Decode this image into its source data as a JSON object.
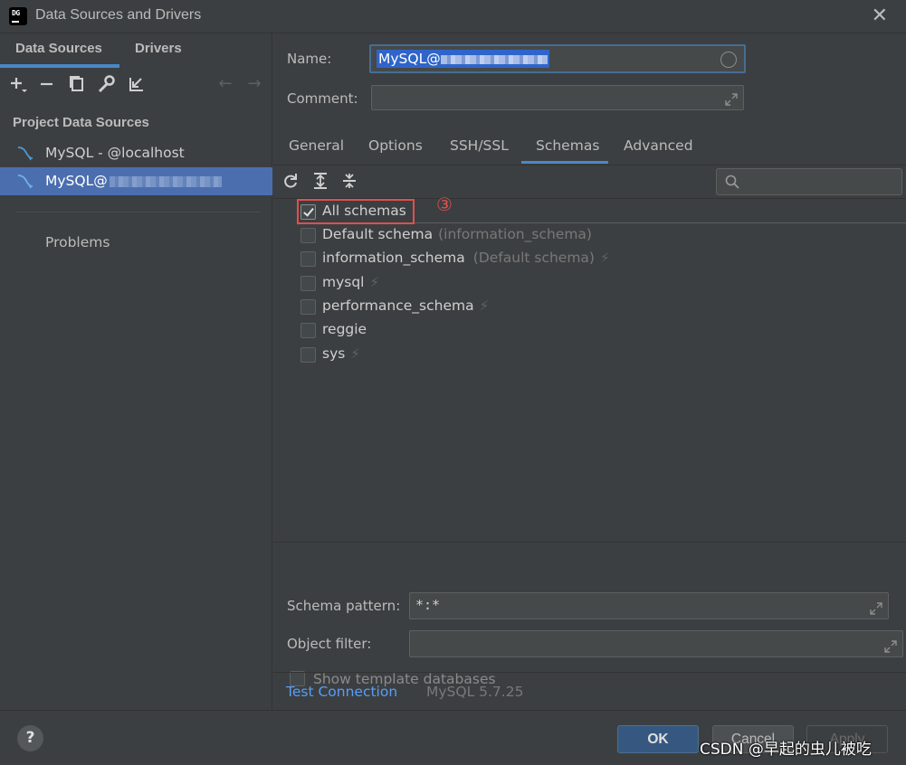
{
  "window": {
    "title": "Data Sources and Drivers"
  },
  "left_tabs": [
    "Data Sources",
    "Drivers"
  ],
  "section_title": "Project Data Sources",
  "data_sources": [
    {
      "label": "MySQL - @localhost"
    },
    {
      "label": "MySQL@"
    }
  ],
  "problems_label": "Problems",
  "form": {
    "name_label": "Name:",
    "name_value": "MySQL@",
    "comment_label": "Comment:",
    "comment_value": ""
  },
  "tabs": [
    "General",
    "Options",
    "SSH/SSL",
    "Schemas",
    "Advanced"
  ],
  "active_tab": "Schemas",
  "search": {
    "placeholder": ""
  },
  "schemas": [
    {
      "name": "All schemas",
      "note": "",
      "checked": true,
      "bolt": false
    },
    {
      "name": "Default schema",
      "note": "(information_schema)",
      "checked": false,
      "bolt": false
    },
    {
      "name": "information_schema",
      "note": "(Default schema)",
      "checked": false,
      "bolt": true
    },
    {
      "name": "mysql",
      "note": "",
      "checked": false,
      "bolt": true
    },
    {
      "name": "performance_schema",
      "note": "",
      "checked": false,
      "bolt": true
    },
    {
      "name": "reggie",
      "note": "",
      "checked": false,
      "bolt": false
    },
    {
      "name": "sys",
      "note": "",
      "checked": false,
      "bolt": true
    }
  ],
  "annotation": {
    "marker": "③",
    "color": "#e04f4f"
  },
  "schema_pattern": {
    "label": "Schema pattern:",
    "value": "*:*"
  },
  "object_filter": {
    "label": "Object filter:",
    "value": ""
  },
  "show_template": {
    "label": "Show template databases",
    "checked": false
  },
  "test_connection": "Test Connection",
  "server_version": "MySQL 5.7.25",
  "buttons": {
    "help": "?",
    "ok": "OK",
    "cancel": "Cancel",
    "apply": "Apply"
  },
  "watermark": "CSDN @早起的虫儿被吃",
  "colors": {
    "accent": "#4a88c7",
    "selection": "#4b6eaf",
    "link": "#589df6"
  }
}
